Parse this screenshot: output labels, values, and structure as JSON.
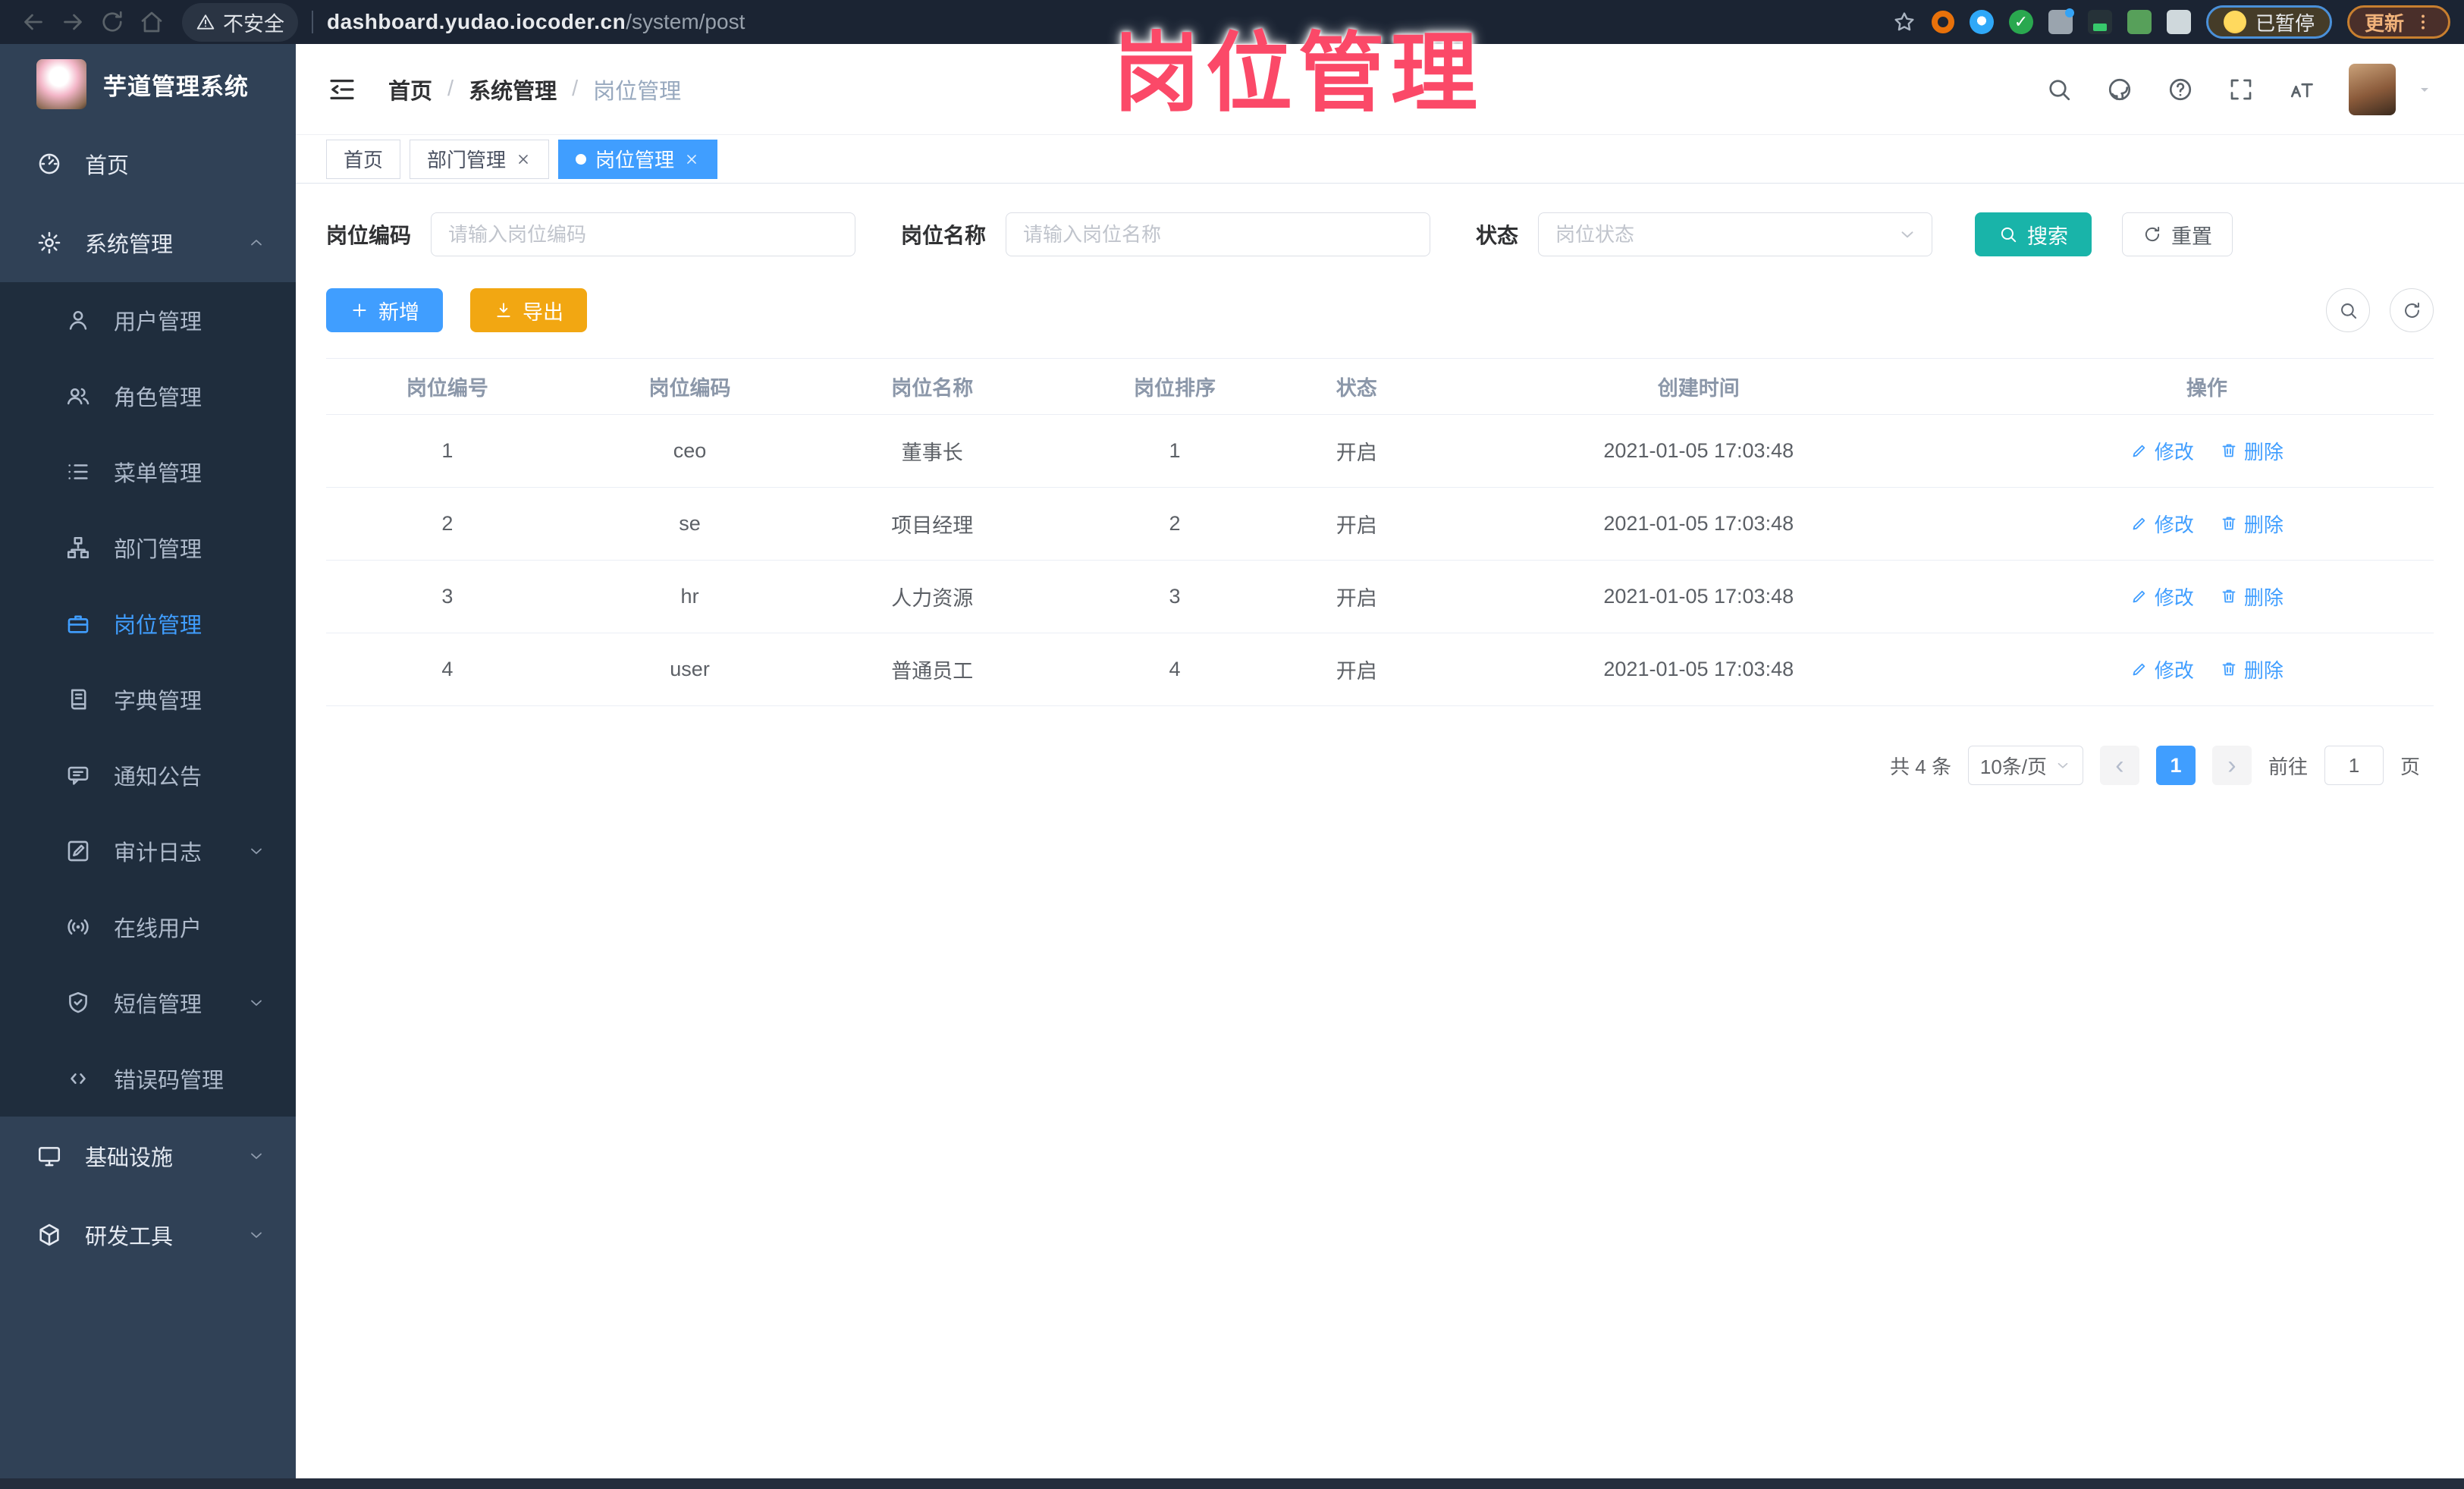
{
  "browser": {
    "nav_icons": [
      "arrow-left-icon",
      "arrow-right-icon",
      "reload-icon",
      "home-icon"
    ],
    "security_label": "不安全",
    "url_host": "dashboard.yudao.iocoder.cn",
    "url_path": "/system/post",
    "extension_icons": [
      "ext-orange-circle-icon",
      "ext-blue-pin-icon",
      "ext-green-check-icon",
      "ext-grid-icon",
      "ext-dark-card-icon",
      "ext-sprout-icon",
      "ext-puzzle-icon"
    ],
    "paused_badge": "已暂停",
    "update_button": "更新"
  },
  "watermark": {
    "text": "岗位管理",
    "color": "#fb4968"
  },
  "sidebar": {
    "title": "芋道管理系统",
    "items": [
      {
        "key": "home",
        "label": "首页",
        "icon": "dashboard-icon",
        "level": "root"
      },
      {
        "key": "system",
        "label": "系统管理",
        "icon": "gear-icon",
        "level": "root",
        "expanded": true,
        "chevron": "up"
      },
      {
        "key": "users",
        "label": "用户管理",
        "icon": "user-icon",
        "level": "sub"
      },
      {
        "key": "roles",
        "label": "角色管理",
        "icon": "users-icon",
        "level": "sub"
      },
      {
        "key": "menus",
        "label": "菜单管理",
        "icon": "menu-list-icon",
        "level": "sub"
      },
      {
        "key": "departments",
        "label": "部门管理",
        "icon": "org-tree-icon",
        "level": "sub"
      },
      {
        "key": "posts",
        "label": "岗位管理",
        "icon": "briefcase-icon",
        "level": "sub",
        "active": true
      },
      {
        "key": "dictionaries",
        "label": "字典管理",
        "icon": "dictionary-icon",
        "level": "sub"
      },
      {
        "key": "announcements",
        "label": "通知公告",
        "icon": "announcement-icon",
        "level": "sub"
      },
      {
        "key": "audit-logs",
        "label": "审计日志",
        "icon": "audit-log-icon",
        "level": "sub",
        "chevron": "down"
      },
      {
        "key": "online-users",
        "label": "在线用户",
        "icon": "online-user-icon",
        "level": "sub"
      },
      {
        "key": "sms",
        "label": "短信管理",
        "icon": "sms-shield-icon",
        "level": "sub",
        "chevron": "down"
      },
      {
        "key": "error-codes",
        "label": "错误码管理",
        "icon": "error-code-icon",
        "level": "sub"
      },
      {
        "key": "infrastructure",
        "label": "基础设施",
        "icon": "infrastructure-icon",
        "level": "root",
        "chevron": "down"
      },
      {
        "key": "dev-tools",
        "label": "研发工具",
        "icon": "dev-tools-icon",
        "level": "root",
        "chevron": "down"
      }
    ]
  },
  "breadcrumb": {
    "items": [
      "首页",
      "系统管理",
      "岗位管理"
    ],
    "separator": "/"
  },
  "header_icons": [
    "magnifier-icon",
    "github-icon",
    "help-icon",
    "fullscreen-icon",
    "font-size-icon"
  ],
  "tabs": [
    {
      "key": "home",
      "label": "首页",
      "closable": false,
      "active": false
    },
    {
      "key": "departments",
      "label": "部门管理",
      "closable": true,
      "active": false
    },
    {
      "key": "posts",
      "label": "岗位管理",
      "closable": true,
      "active": true
    }
  ],
  "filters": {
    "post_code": {
      "label": "岗位编码",
      "placeholder": "请输入岗位编码"
    },
    "post_name": {
      "label": "岗位名称",
      "placeholder": "请输入岗位名称"
    },
    "status": {
      "label": "状态",
      "placeholder": "岗位状态"
    },
    "search_label": "搜索",
    "reset_label": "重置"
  },
  "toolbar": {
    "add_label": "新增",
    "export_label": "导出",
    "icon_buttons": [
      "magnifier-icon",
      "refresh-icon"
    ]
  },
  "table": {
    "columns": [
      "岗位编号",
      "岗位编码",
      "岗位名称",
      "岗位排序",
      "状态",
      "创建时间",
      "操作"
    ],
    "rows": [
      {
        "id": "1",
        "code": "ceo",
        "name": "董事长",
        "sort": "1",
        "status": "开启",
        "created": "2021-01-05 17:03:48"
      },
      {
        "id": "2",
        "code": "se",
        "name": "项目经理",
        "sort": "2",
        "status": "开启",
        "created": "2021-01-05 17:03:48"
      },
      {
        "id": "3",
        "code": "hr",
        "name": "人力资源",
        "sort": "3",
        "status": "开启",
        "created": "2021-01-05 17:03:48"
      },
      {
        "id": "4",
        "code": "user",
        "name": "普通员工",
        "sort": "4",
        "status": "开启",
        "created": "2021-01-05 17:03:48"
      }
    ],
    "edit_label": "修改",
    "delete_label": "删除"
  },
  "pagination": {
    "total_text": "共 4 条",
    "page_size": "10条/页",
    "current_page": "1",
    "goto_label": "前往",
    "goto_value": "1",
    "page_suffix": "页"
  }
}
